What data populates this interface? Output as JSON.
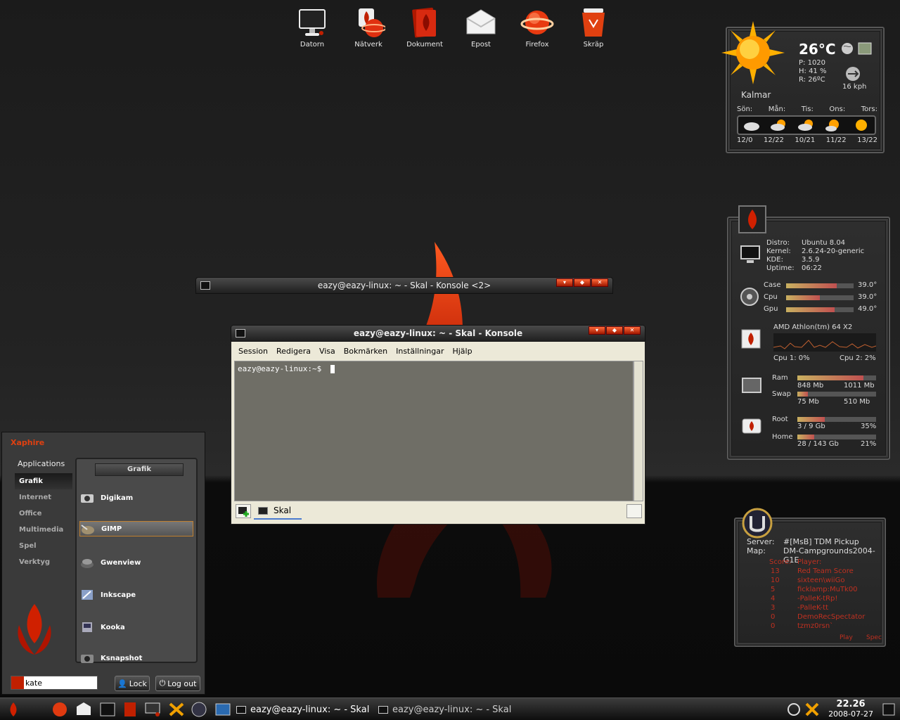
{
  "desktop": {
    "icons": [
      {
        "name": "datorn-icon",
        "label": "Datorn"
      },
      {
        "name": "natverk-icon",
        "label": "Nätverk"
      },
      {
        "name": "dokument-icon",
        "label": "Dokument"
      },
      {
        "name": "epost-icon",
        "label": "Epost"
      },
      {
        "name": "firefox-icon",
        "label": "Firefox"
      },
      {
        "name": "skrap-icon",
        "label": "Skräp"
      }
    ]
  },
  "weather": {
    "temp": "26°C",
    "pressure": "P: 1020",
    "humidity": "H: 41 %",
    "real": "R: 26ºC",
    "wind": "16 kph",
    "city": "Kalmar",
    "days": [
      "Sön:",
      "Mån:",
      "Tis:",
      "Ons:",
      "Tors:"
    ],
    "temps": [
      "12/0",
      "12/22",
      "10/21",
      "11/22",
      "13/22"
    ]
  },
  "sysmon": {
    "distro_label": "Distro:",
    "distro": "Ubuntu 8.04",
    "kernel_label": "Kernel:",
    "kernel": "2.6.24-20-generic",
    "kde_label": "KDE:",
    "kde": "3.5.9",
    "uptime_label": "Uptime:",
    "uptime": "06:22",
    "temps": [
      {
        "label": "Case",
        "value": "39.0°",
        "fill": 0.75
      },
      {
        "label": "Cpu",
        "value": "39.0°",
        "fill": 0.5
      },
      {
        "label": "Gpu",
        "value": "49.0°",
        "fill": 0.72
      }
    ],
    "cpu_name": "AMD Athlon(tm) 64 X2",
    "cpu1": "Cpu 1: 0%",
    "cpu2": "Cpu 2: 2%",
    "ram_label": "Ram",
    "ram_used": "848 Mb",
    "ram_total": "1011 Mb",
    "ram_fill": 0.84,
    "swap_label": "Swap",
    "swap_used": "75 Mb",
    "swap_total": "510 Mb",
    "swap_fill": 0.13,
    "root_label": "Root",
    "root_used": "3 / 9 Gb",
    "root_pct": "35%",
    "root_fill": 0.35,
    "home_label": "Home",
    "home_used": "28 / 143 Gb",
    "home_pct": "21%",
    "home_fill": 0.21
  },
  "ut": {
    "server_label": "Server:",
    "server": "#[MsB] TDM Pickup",
    "map_label": "Map:",
    "map": "DM-Campgrounds2004-G1E",
    "score_header": "Score:",
    "player_header": "Player:",
    "players": [
      {
        "score": "13",
        "name": "Red Team Score"
      },
      {
        "score": "10",
        "name": "sixteen\\wiiGo"
      },
      {
        "score": "5",
        "name": "ficklamp:MuTk00"
      },
      {
        "score": "4",
        "name": "-PalleK-tRp!"
      },
      {
        "score": "3",
        "name": "-PalleK-tt"
      },
      {
        "score": "0",
        "name": "DemoRecSpectator"
      },
      {
        "score": "0",
        "name": "tzmz0rsn`"
      }
    ],
    "play": "Play",
    "spec": "Spec"
  },
  "konsole_bg": {
    "title": "eazy@eazy-linux: ~ - Skal - Konsole <2>"
  },
  "konsole": {
    "title": "eazy@eazy-linux: ~ - Skal - Konsole",
    "menu": [
      "Session",
      "Redigera",
      "Visa",
      "Bokmärken",
      "Inställningar",
      "Hjälp"
    ],
    "prompt": "eazy@eazy-linux:~$",
    "tab": "Skal"
  },
  "appmenu": {
    "brand": "Xaphire",
    "header": "Applications",
    "categories": [
      "Grafik",
      "Internet",
      "Office",
      "Multimedia",
      "Spel",
      "Verktyg"
    ],
    "section": "Grafik",
    "apps": [
      "Digikam",
      "GIMP",
      "Gwenview",
      "Inkscape",
      "Kooka",
      "Ksnapshot"
    ],
    "search_value": "kate",
    "lock": "Lock",
    "logout": "Log out"
  },
  "taskbar": {
    "tasks": [
      "eazy@eazy-linux: ~ - Skal",
      "eazy@eazy-linux: ~ - Skal"
    ],
    "time": "22.26",
    "date": "2008-07-27"
  },
  "colors": {
    "accent": "#c02000",
    "flame": "#b81800"
  }
}
